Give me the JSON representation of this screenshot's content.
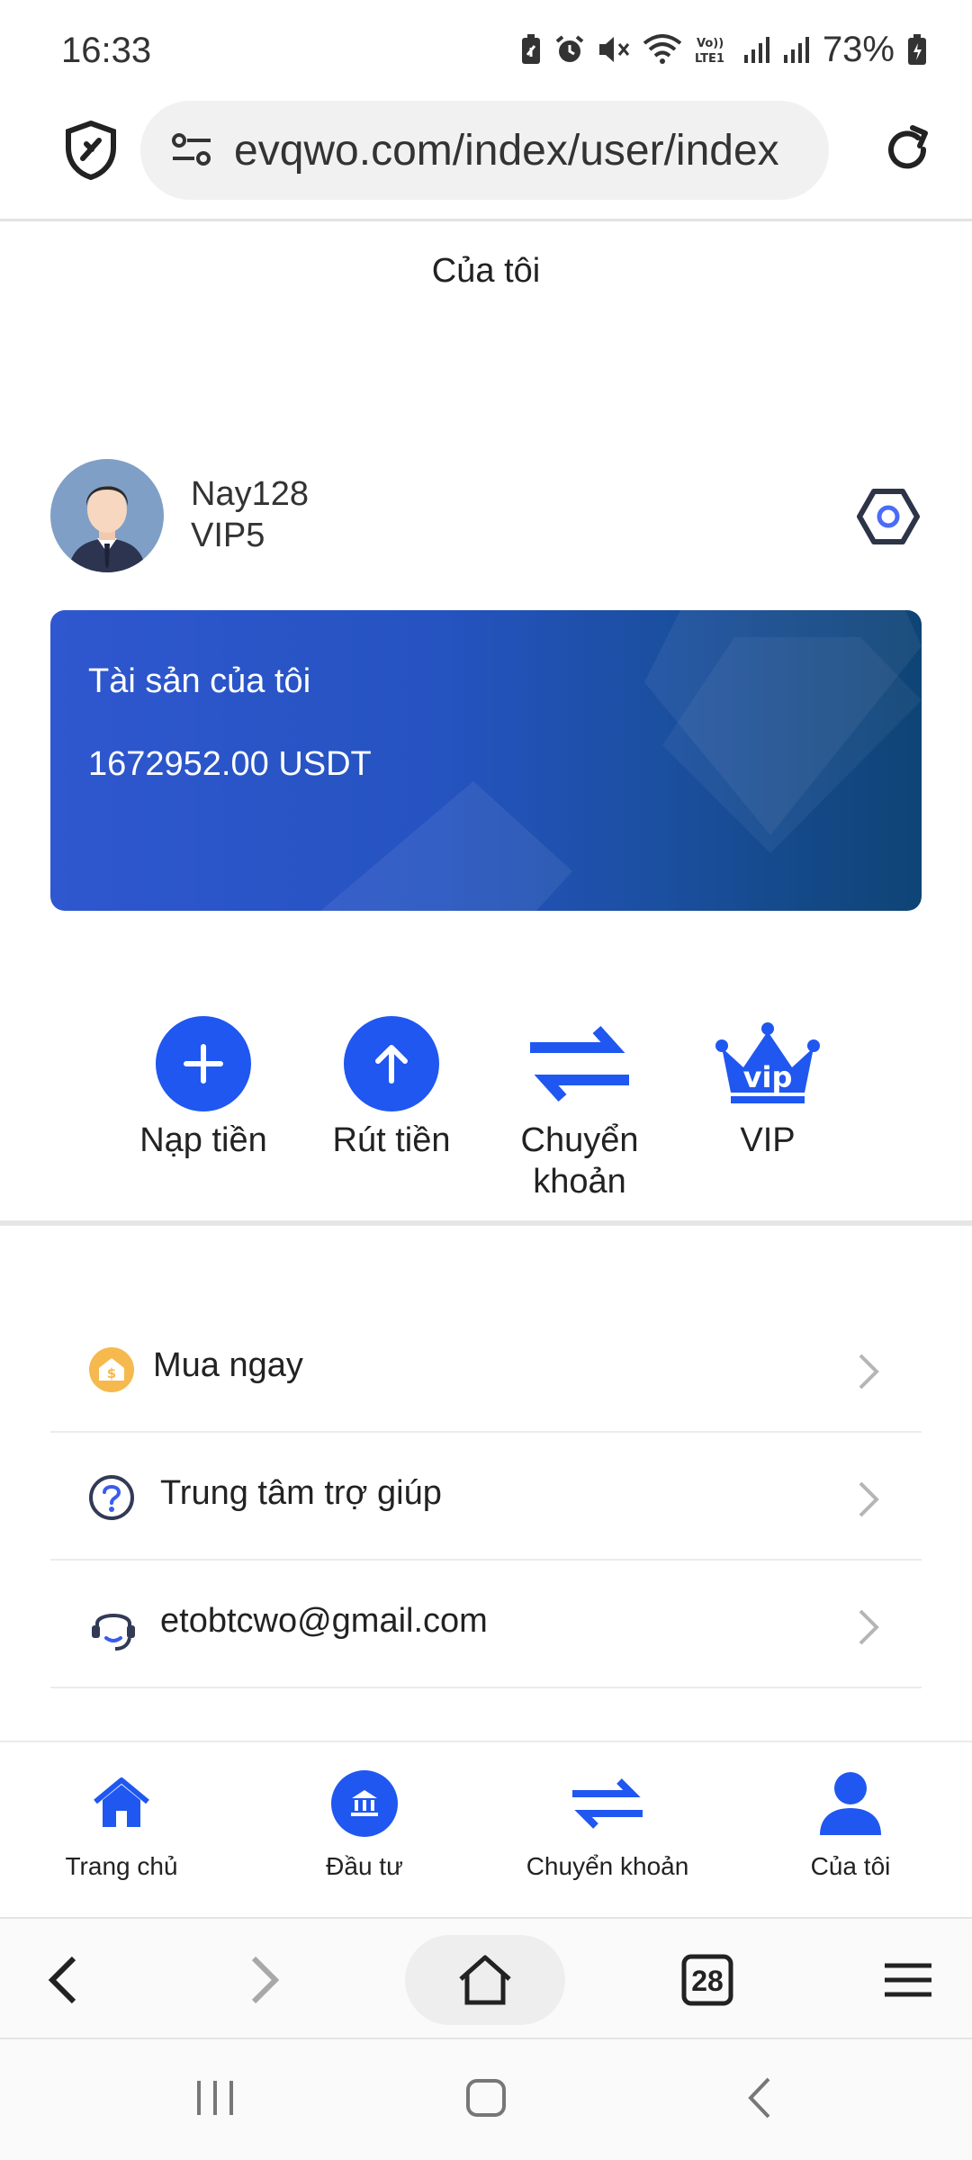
{
  "status_bar": {
    "time": "16:33",
    "battery": "73%",
    "icons": [
      "battery-saver-icon",
      "alarm-icon",
      "mute-icon",
      "wifi-icon",
      "volte-icon",
      "signal-icon",
      "signal-icon",
      "battery-icon"
    ]
  },
  "browser": {
    "url": "evqwo.com/index/user/index",
    "tab_count": "28"
  },
  "page": {
    "title": "Của tôi"
  },
  "profile": {
    "username": "Nay128",
    "level": "VIP5"
  },
  "asset_card": {
    "label": "Tài sản của tôi",
    "value": "1672952.00 USDT"
  },
  "actions": [
    {
      "label": "Nạp tiền",
      "icon": "plus-icon"
    },
    {
      "label": "Rút tiền",
      "icon": "arrow-up-icon"
    },
    {
      "label": "Chuyển khoản",
      "icon": "transfer-icon"
    },
    {
      "label": "VIP",
      "icon": "vip-crown-icon"
    }
  ],
  "menu": [
    {
      "label": "Mua ngay",
      "icon": "shop-icon"
    },
    {
      "label": "Trung tâm trợ giúp",
      "icon": "help-icon"
    },
    {
      "label": "etobtcwo@gmail.com",
      "icon": "headset-icon"
    }
  ],
  "tabbar": [
    {
      "label": "Trang chủ",
      "icon": "home-icon"
    },
    {
      "label": "Đầu tư",
      "icon": "bank-icon"
    },
    {
      "label": "Chuyển khoản",
      "icon": "transfer-icon"
    },
    {
      "label": "Của tôi",
      "icon": "user-icon"
    }
  ],
  "colors": {
    "accent": "#1f57f0",
    "card_start": "#2f57cf",
    "card_end": "#0e4475"
  }
}
